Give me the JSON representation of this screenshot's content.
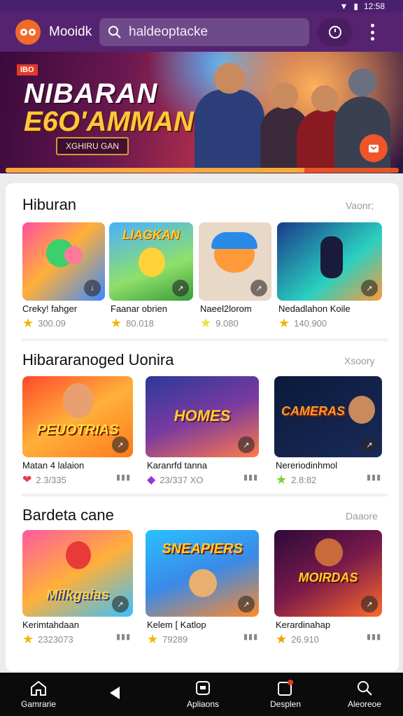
{
  "status": {
    "time": "12:58"
  },
  "header": {
    "app_title": "Mooidk",
    "search_query": "haldeoptacke",
    "logo_icon": "mascot-eyes-icon"
  },
  "banner": {
    "badge": "IBO",
    "title_line1": "NIBARAN",
    "title_line2": "E6O'AMMAN",
    "subtitle": "XGHIRU GAN",
    "progress": 0.76
  },
  "sections": [
    {
      "title": "Hiburan",
      "see_all": "Vaonr;",
      "items": [
        {
          "name": "Creky! fahger",
          "rating": "300.09"
        },
        {
          "name": "Faanar obrien",
          "rating": "80.018"
        },
        {
          "name": "Naeel2lorom",
          "rating": "9.080"
        },
        {
          "name": "Nedadlahon Koile",
          "rating": "140.900"
        }
      ]
    },
    {
      "title": "Hibararanoged Uonira",
      "see_all": "Xsoory",
      "items": [
        {
          "name": "Matan 4 lalaion",
          "rating": "2.3/335",
          "art": "PEUOTRIAS"
        },
        {
          "name": "Karanrfd tanna",
          "rating": "23/337 XO",
          "art": "HOMES"
        },
        {
          "name": "Nereriodinhmol",
          "rating": "2.8:82",
          "art": "CAMERAS"
        }
      ]
    },
    {
      "title": "Bardeta cane",
      "see_all": "Daaore",
      "items": [
        {
          "name": "Kerimtahdaan",
          "rating": "2323073",
          "art": "Milkgaias"
        },
        {
          "name": "Kelem [ Katlop",
          "rating": "79289",
          "art": "SNEAPIERS"
        },
        {
          "name": "Kerardinahap",
          "rating": "26.910",
          "art": "MOIRDAS"
        }
      ]
    }
  ],
  "nav": [
    {
      "label": "Gamrarie",
      "icon": "home-icon"
    },
    {
      "label": "",
      "icon": "back-icon"
    },
    {
      "label": "Apliaons",
      "icon": "apps-icon"
    },
    {
      "label": "Desplen",
      "icon": "notification-icon"
    },
    {
      "label": "Aleoreoe",
      "icon": "search-icon"
    }
  ]
}
